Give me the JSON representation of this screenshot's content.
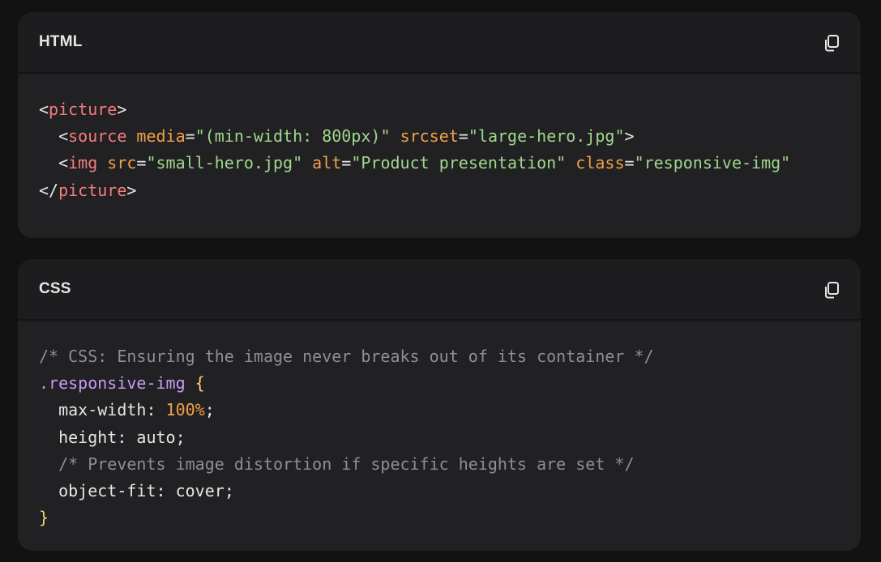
{
  "blocks": [
    {
      "language": "HTML",
      "copy_icon": "copy-icon",
      "lines": [
        [
          {
            "t": "<",
            "k": "punct"
          },
          {
            "t": "picture",
            "k": "tag"
          },
          {
            "t": ">",
            "k": "punct"
          }
        ],
        [
          {
            "t": "  <",
            "k": "punct"
          },
          {
            "t": "source",
            "k": "tag"
          },
          {
            "t": " ",
            "k": "punct"
          },
          {
            "t": "media",
            "k": "attr"
          },
          {
            "t": "=",
            "k": "punct"
          },
          {
            "t": "\"(min-width: 800px)\"",
            "k": "string"
          },
          {
            "t": " ",
            "k": "punct"
          },
          {
            "t": "srcset",
            "k": "attr"
          },
          {
            "t": "=",
            "k": "punct"
          },
          {
            "t": "\"large-hero.jpg\"",
            "k": "string"
          },
          {
            "t": ">",
            "k": "punct"
          }
        ],
        [
          {
            "t": "  <",
            "k": "punct"
          },
          {
            "t": "img",
            "k": "tag"
          },
          {
            "t": " ",
            "k": "punct"
          },
          {
            "t": "src",
            "k": "attr"
          },
          {
            "t": "=",
            "k": "punct"
          },
          {
            "t": "\"small-hero.jpg\"",
            "k": "string"
          },
          {
            "t": " ",
            "k": "punct"
          },
          {
            "t": "alt",
            "k": "attr"
          },
          {
            "t": "=",
            "k": "punct"
          },
          {
            "t": "\"Product presentation\"",
            "k": "string"
          },
          {
            "t": " ",
            "k": "punct"
          },
          {
            "t": "class",
            "k": "attr"
          },
          {
            "t": "=",
            "k": "punct"
          },
          {
            "t": "\"responsive-img\"",
            "k": "string"
          }
        ],
        [
          {
            "t": "</",
            "k": "punct"
          },
          {
            "t": "picture",
            "k": "tag"
          },
          {
            "t": ">",
            "k": "punct"
          }
        ]
      ]
    },
    {
      "language": "CSS",
      "copy_icon": "copy-icon",
      "lines": [
        [
          {
            "t": "/* CSS: Ensuring the image never breaks out of its container */",
            "k": "comment"
          }
        ],
        [
          {
            "t": ".responsive-img",
            "k": "selector"
          },
          {
            "t": " ",
            "k": "punct"
          },
          {
            "t": "{",
            "k": "brace"
          }
        ],
        [
          {
            "t": "  max-width",
            "k": "prop"
          },
          {
            "t": ": ",
            "k": "punct"
          },
          {
            "t": "100%",
            "k": "number"
          },
          {
            "t": ";",
            "k": "punct"
          }
        ],
        [
          {
            "t": "  height",
            "k": "prop"
          },
          {
            "t": ": ",
            "k": "punct"
          },
          {
            "t": "auto",
            "k": "value"
          },
          {
            "t": ";",
            "k": "punct"
          }
        ],
        [
          {
            "t": "  /* Prevents image distortion if specific heights are set */",
            "k": "comment"
          }
        ],
        [
          {
            "t": "  object-fit",
            "k": "prop"
          },
          {
            "t": ": ",
            "k": "punct"
          },
          {
            "t": "cover",
            "k": "value"
          },
          {
            "t": ";",
            "k": "punct"
          }
        ],
        [
          {
            "t": "}",
            "k": "brace"
          }
        ]
      ]
    }
  ]
}
